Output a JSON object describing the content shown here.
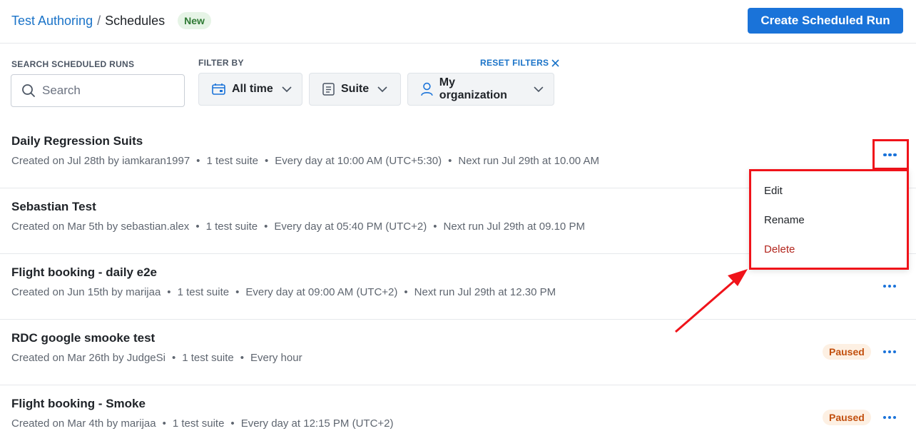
{
  "header": {
    "breadcrumb_parent": "Test Authoring",
    "breadcrumb_sep": "/",
    "breadcrumb_current": "Schedules",
    "badge": "New",
    "create_button": "Create Scheduled Run"
  },
  "filters": {
    "search_label": "SEARCH SCHEDULED RUNS",
    "search_placeholder": "Search",
    "filter_by_label": "FILTER BY",
    "reset_label": "RESET FILTERS",
    "time": "All time",
    "suite": "Suite",
    "org": "My organization"
  },
  "rows": [
    {
      "title": "Daily Regression Suits",
      "created": "Created on Jul 28th by iamkaran1997",
      "suites": "1 test suite",
      "schedule": "Every day at 10:00 AM (UTC+5:30)",
      "next": "Next run Jul 29th at 10.00 AM"
    },
    {
      "title": "Sebastian Test",
      "created": "Created on Mar 5th by sebastian.alex",
      "suites": "1 test suite",
      "schedule": "Every day at 05:40 PM (UTC+2)",
      "next": "Next run Jul 29th at 09.10 PM"
    },
    {
      "title": "Flight booking - daily e2e",
      "created": "Created on Jun 15th by marijaa",
      "suites": "1 test suite",
      "schedule": "Every day at 09:00 AM (UTC+2)",
      "next": "Next run Jul 29th at 12.30 PM"
    },
    {
      "title": "RDC google smooke test",
      "created": "Created on Mar 26th by JudgeSi",
      "suites": "1 test suite",
      "schedule": "Every hour",
      "status": "Paused"
    },
    {
      "title": "Flight booking - Smoke",
      "created": "Created on Mar 4th by marijaa",
      "suites": "1 test suite",
      "schedule": "Every day at 12:15 PM (UTC+2)",
      "status": "Paused"
    }
  ],
  "menu": {
    "edit": "Edit",
    "rename": "Rename",
    "delete": "Delete"
  },
  "colors": {
    "accent": "#1a73d9",
    "annotation": "#f0131a",
    "delete": "#b3261e",
    "paused_bg": "#fdf0e3",
    "paused_text": "#c2500f"
  }
}
